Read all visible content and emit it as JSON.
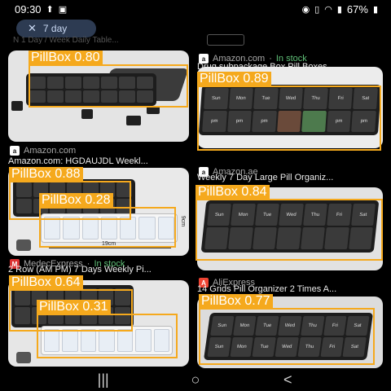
{
  "status_bar": {
    "time": "09:30",
    "battery": "67%"
  },
  "filter_chip": {
    "label": "7 day"
  },
  "faded_text": "N 1 Day / Week Daily Table...",
  "results": [
    {
      "source": "Amazon.com",
      "in_stock": "",
      "title": "Amazon.com: HGDAUJDL Weekl..."
    },
    {
      "source": "Amazon.com",
      "in_stock": "In stock",
      "title": "Drug subpackage Box,Pill Boxes,..."
    },
    {
      "source": "MedecExpress",
      "in_stock": "In stock",
      "title": "2 Row (AM PM) 7 Days Weekly Pi..."
    },
    {
      "source": "Amazon.ae",
      "in_stock": "",
      "title": "Weekly 7 Day Large Pill Organiz..."
    },
    {
      "source": "AliExpress",
      "in_stock": "",
      "title": "14 Grids Pill Organizer 2 Times A..."
    }
  ],
  "dimension_labels": {
    "width": "19cm",
    "depth": "9cm"
  },
  "detections": [
    {
      "label": "PillBox",
      "score": "0.80"
    },
    {
      "label": "PillBox",
      "score": "0.89"
    },
    {
      "label": "PillBox",
      "score": "0.88"
    },
    {
      "label": "PillBox",
      "score": "0.28"
    },
    {
      "label": "PillBox",
      "score": "0.84"
    },
    {
      "label": "PillBox",
      "score": "0.64"
    },
    {
      "label": "PillBox",
      "score": "0.31"
    },
    {
      "label": "PillBox",
      "score": "0.77"
    }
  ],
  "nav": {
    "recents": "|||",
    "home": "○",
    "back": "<"
  },
  "colors": {
    "detection": "#f5a91d",
    "in_stock": "#5fbf77",
    "chip_bg": "#2d3b52"
  }
}
